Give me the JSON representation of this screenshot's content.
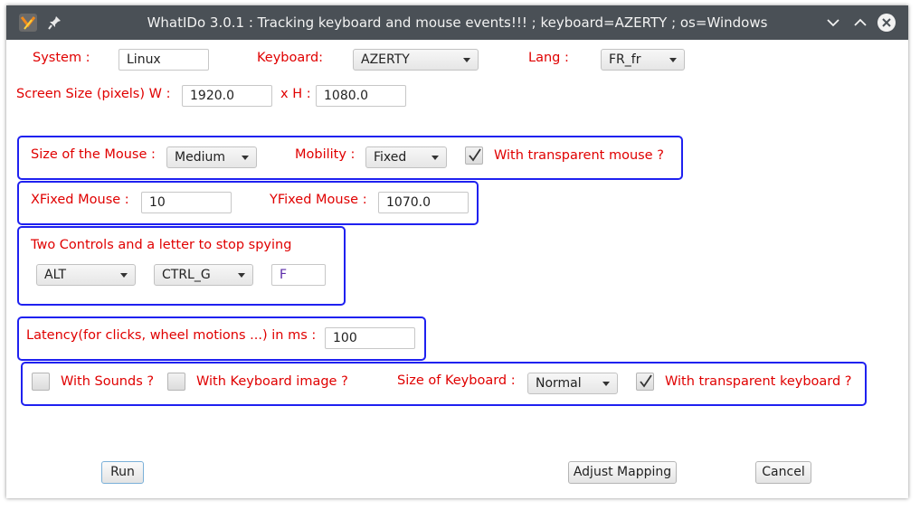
{
  "window": {
    "title": "WhatIDo 3.0.1 : Tracking keyboard and mouse events!!! ; keyboard=AZERTY ; os=Windows"
  },
  "system": {
    "label": "System :",
    "value": "Linux"
  },
  "keyboard": {
    "label": "Keyboard:",
    "selected": "AZERTY"
  },
  "lang": {
    "label": "Lang :",
    "selected": "FR_fr"
  },
  "screen": {
    "label_w": "Screen Size (pixels) W :",
    "width": "1920.0",
    "label_h": "x H :",
    "height": "1080.0"
  },
  "mouse": {
    "size_label": "Size of the Mouse :",
    "size_selected": "Medium",
    "mobility_label": "Mobility :",
    "mobility_selected": "Fixed",
    "transparent_label": "With transparent mouse  ?",
    "transparent_checked": true
  },
  "fixed": {
    "x_label": "XFixed Mouse :",
    "x_value": "10",
    "y_label": "YFixed Mouse :",
    "y_value": "1070.0"
  },
  "stop": {
    "label": "Two Controls and a letter to stop spying",
    "control1": "ALT",
    "control2": "CTRL_G",
    "letter": "F"
  },
  "latency": {
    "label": "Latency(for clicks, wheel motions ...) in ms :",
    "value": "100"
  },
  "options": {
    "sounds_label": "With Sounds ?",
    "sounds_checked": false,
    "kb_image_label": "With Keyboard image ?",
    "kb_image_checked": false,
    "kb_size_label": "Size of Keyboard :",
    "kb_size_selected": "Normal",
    "kb_transparent_label": "With transparent keyboard ?",
    "kb_transparent_checked": true
  },
  "buttons": {
    "run": "Run",
    "adjust": "Adjust Mapping",
    "cancel": "Cancel"
  },
  "colors": {
    "label_red": "#e00000",
    "group_border": "#1f21f0",
    "titlebar": "#4a5056"
  },
  "icons": {
    "app": "app-logo-icon",
    "pin": "pin-icon",
    "minimize": "chevron-down-icon",
    "maximize": "chevron-up-icon",
    "close": "close-icon"
  }
}
